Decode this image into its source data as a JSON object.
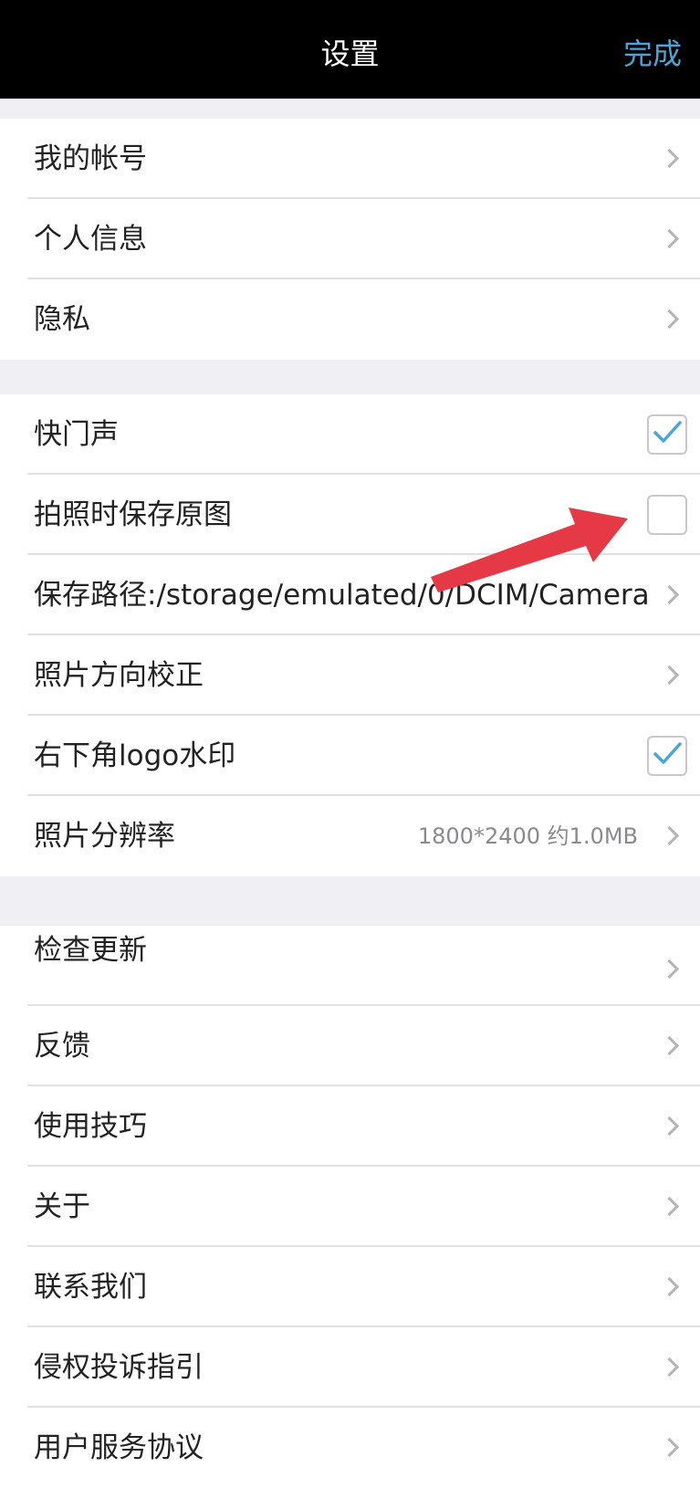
{
  "header": {
    "title": "设置",
    "done": "完成"
  },
  "groups": [
    {
      "items": [
        {
          "label": "我的帐号"
        },
        {
          "label": "个人信息"
        },
        {
          "label": "隐私"
        }
      ]
    },
    {
      "items": [
        {
          "label": "快门声",
          "checked": true
        },
        {
          "label": "拍照时保存原图",
          "checked": false
        },
        {
          "label": "保存路径:/storage/emulated/0/DCIM/Camera"
        },
        {
          "label": "照片方向校正"
        },
        {
          "label": "右下角logo水印",
          "checked": true
        },
        {
          "label": "照片分辨率",
          "value": "1800*2400 约1.0MB"
        }
      ]
    },
    {
      "items": [
        {
          "label": "检查更新"
        },
        {
          "label": "反馈"
        },
        {
          "label": "使用技巧"
        },
        {
          "label": "关于"
        },
        {
          "label": "联系我们"
        },
        {
          "label": "侵权投诉指引"
        },
        {
          "label": "用户服务协议"
        }
      ]
    }
  ],
  "colors": {
    "accent": "#4aa6d6",
    "arrow": "#e53945",
    "header_bg": "#000000",
    "page_bg": "#efeff4"
  },
  "icons": {
    "chevron": "chevron-right-icon",
    "check": "checkmark-icon",
    "annotation": "red-arrow-annotation"
  }
}
